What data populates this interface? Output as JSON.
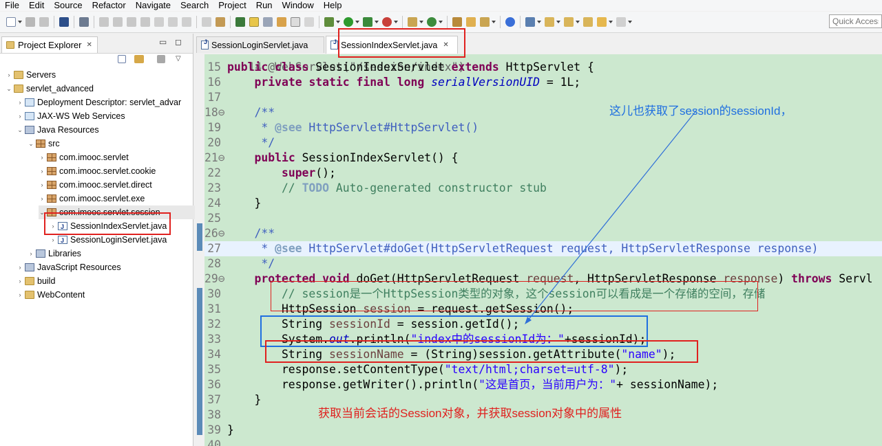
{
  "menu": [
    "File",
    "Edit",
    "Source",
    "Refactor",
    "Navigate",
    "Search",
    "Project",
    "Run",
    "Window",
    "Help"
  ],
  "toolbar": {
    "quick_access_placeholder": "Quick Access"
  },
  "explorer": {
    "title": "Project Explorer",
    "close_glyph": "✕",
    "minimize_glyph": "▭",
    "maximize_glyph": "◻",
    "tree": [
      {
        "label": "Servers",
        "icon": "folder",
        "depth": 0,
        "arrow": "›"
      },
      {
        "label": "servlet_advanced",
        "icon": "folder",
        "depth": 0,
        "arrow": "⌄"
      },
      {
        "label": "Deployment Descriptor: servlet_advar",
        "icon": "web-descriptor",
        "depth": 1,
        "arrow": "›"
      },
      {
        "label": "JAX-WS Web Services",
        "icon": "web-service",
        "depth": 1,
        "arrow": "›"
      },
      {
        "label": "Java Resources",
        "icon": "java-resources",
        "depth": 1,
        "arrow": "⌄"
      },
      {
        "label": "src",
        "icon": "source-folder",
        "depth": 2,
        "arrow": "⌄"
      },
      {
        "label": "com.imooc.servlet",
        "icon": "package",
        "depth": 3,
        "arrow": "›"
      },
      {
        "label": "com.imooc.servlet.cookie",
        "icon": "package",
        "depth": 3,
        "arrow": "›"
      },
      {
        "label": "com.imooc.servlet.direct",
        "icon": "package",
        "depth": 3,
        "arrow": "›"
      },
      {
        "label": "com.imooc.servlet.exe",
        "icon": "package",
        "depth": 3,
        "arrow": "›"
      },
      {
        "label": "com.imooc.servlet.session",
        "icon": "package",
        "depth": 3,
        "arrow": "⌄"
      },
      {
        "label": "SessionIndexServlet.java",
        "icon": "java-file",
        "depth": 4,
        "arrow": "›"
      },
      {
        "label": "SessionLoginServlet.java",
        "icon": "java-file",
        "depth": 4,
        "arrow": "›"
      },
      {
        "label": "Libraries",
        "icon": "library",
        "depth": 2,
        "arrow": "›"
      },
      {
        "label": "JavaScript Resources",
        "icon": "javascript-resources",
        "depth": 1,
        "arrow": "›"
      },
      {
        "label": "build",
        "icon": "folder",
        "depth": 1,
        "arrow": "›"
      },
      {
        "label": "WebContent",
        "icon": "folder",
        "depth": 1,
        "arrow": "›"
      }
    ]
  },
  "editor": {
    "tabs": [
      {
        "label": "SessionLoginServlet.java",
        "active": false
      },
      {
        "label": "SessionIndexServlet.java",
        "active": true,
        "close": "✕"
      }
    ],
    "partial_top_line": "@WebServlet(\"/session/index\")",
    "lines": [
      {
        "n": "15",
        "code": "public class SessionIndexServlet extends HttpServlet {"
      },
      {
        "n": "16",
        "code": "    private static final long serialVersionUID = 1L;"
      },
      {
        "n": "17",
        "code": ""
      },
      {
        "n": "18⊖",
        "code": "    /**"
      },
      {
        "n": "19",
        "code": "     * @see HttpServlet#HttpServlet()"
      },
      {
        "n": "20",
        "code": "     */"
      },
      {
        "n": "21⊖",
        "code": "    public SessionIndexServlet() {"
      },
      {
        "n": "22",
        "code": "        super();"
      },
      {
        "n": "23",
        "code": "        // TODO Auto-generated constructor stub"
      },
      {
        "n": "24",
        "code": "    }"
      },
      {
        "n": "25",
        "code": ""
      },
      {
        "n": "26⊖",
        "code": "    /**"
      },
      {
        "n": "27",
        "code": "     * @see HttpServlet#doGet(HttpServletRequest request, HttpServletResponse response)"
      },
      {
        "n": "28",
        "code": "     */"
      },
      {
        "n": "29⊖",
        "code": "    protected void doGet(HttpServletRequest request, HttpServletResponse response) throws Servl"
      },
      {
        "n": "30",
        "code": "        // session是一个HttpSession类型的对象，这个session可以看成是一个存储的空间，存储"
      },
      {
        "n": "31",
        "code": "        HttpSession session = request.getSession();"
      },
      {
        "n": "32",
        "code": "        String sessionId = session.getId();"
      },
      {
        "n": "33",
        "code": "        System.out.println(\"index中的sessionId为：\"+sessionId);"
      },
      {
        "n": "34",
        "code": "        String sessionName = (String)session.getAttribute(\"name\");"
      },
      {
        "n": "35",
        "code": "        response.setContentType(\"text/html;charset=utf-8\");"
      },
      {
        "n": "36",
        "code": "        response.getWriter().println(\"这是首页，当前用户为：\"+ sessionName);"
      },
      {
        "n": "37",
        "code": "    }"
      },
      {
        "n": "38",
        "code": ""
      },
      {
        "n": "39",
        "code": "}"
      },
      {
        "n": "40",
        "code": ""
      }
    ]
  },
  "annotations": {
    "note_top": "这儿也获取了session的sessionId，",
    "note_bottom": "获取当前会话的Session对象，并获取session对象中的属性"
  },
  "colors": {
    "editor_bg": "#cce8cf",
    "keyword": "#7f0055",
    "comment": "#3f7f5f",
    "javadoc": "#3f5fbf",
    "string": "#2a00ff",
    "field": "#0000c0",
    "red_box": "#e0201e",
    "blue_box": "#1f6fe0",
    "note_blue": "#1f6fe0",
    "note_red": "#e0201e"
  }
}
